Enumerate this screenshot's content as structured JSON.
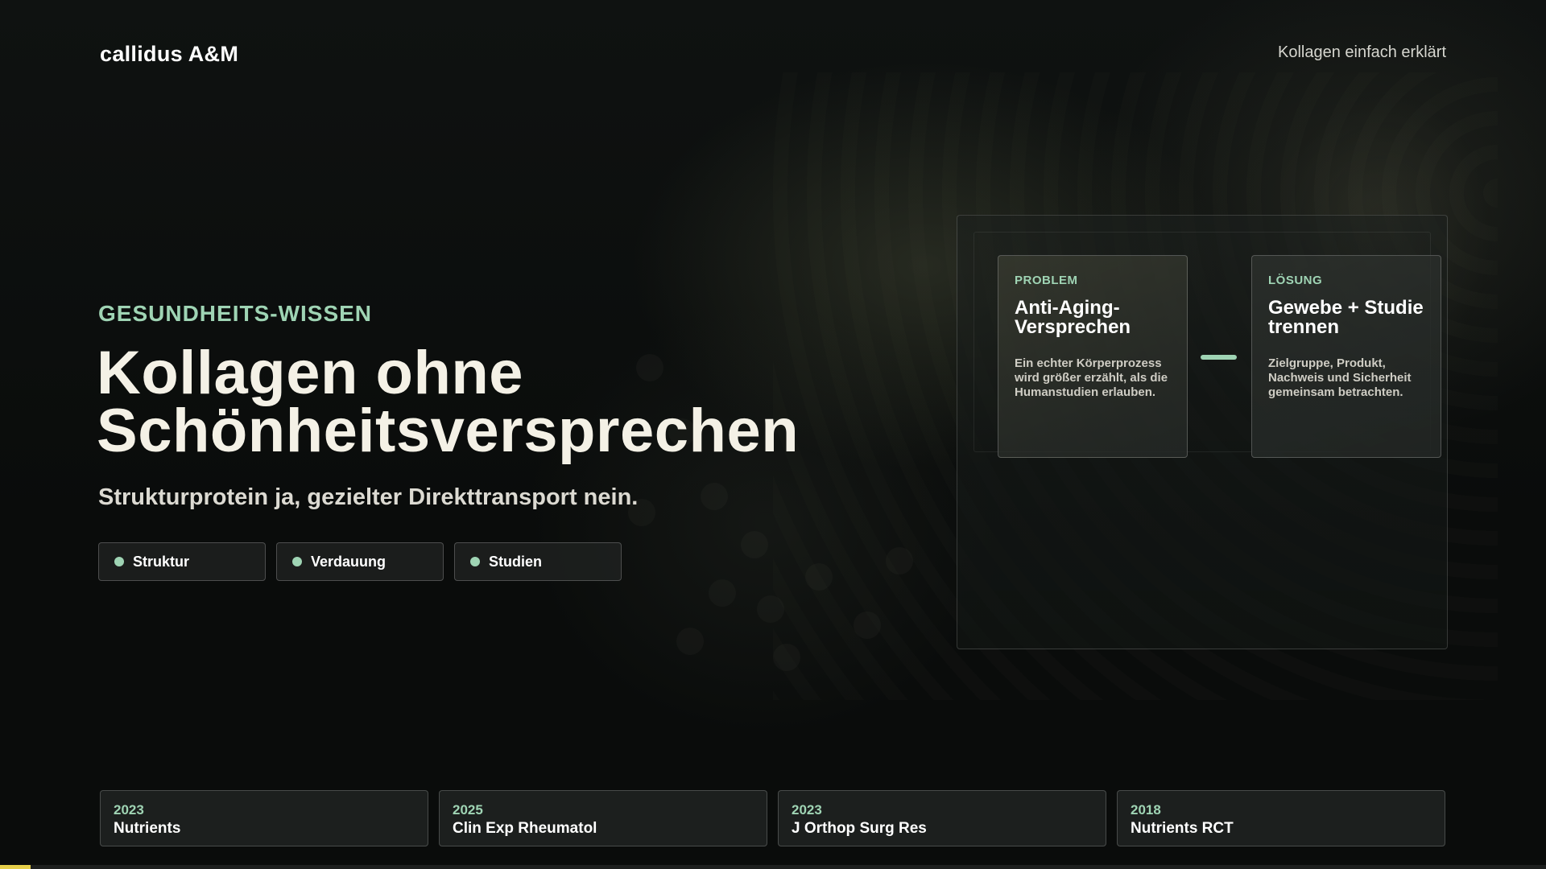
{
  "header": {
    "brand": "callidus A&M",
    "nav_link": "Kollagen einfach erklärt"
  },
  "hero": {
    "eyebrow": "GESUNDHEITS-WISSEN",
    "title_line1": "Kollagen ohne",
    "title_line2": "Schönheitsversprechen",
    "subtitle": "Strukturprotein ja, gezielter Direkttransport nein.",
    "chips": [
      {
        "label": "Struktur"
      },
      {
        "label": "Verdauung"
      },
      {
        "label": "Studien"
      }
    ]
  },
  "panel": {
    "problem": {
      "label": "PROBLEM",
      "title": "Anti-Aging-Versprechen",
      "text": "Ein echter Körperprozess wird größer erzählt, als die Humanstudien erlauben."
    },
    "solution": {
      "label": "LÖSUNG",
      "title": "Gewebe + Studie trennen",
      "text": "Zielgruppe, Produkt, Nachweis und Sicherheit gemeinsam betrachten."
    }
  },
  "references": [
    {
      "year": "2023",
      "journal": "Nutrients"
    },
    {
      "year": "2025",
      "journal": "Clin Exp Rheumatol"
    },
    {
      "year": "2023",
      "journal": "J Orthop Surg Res"
    },
    {
      "year": "2018",
      "journal": "Nutrients RCT"
    }
  ],
  "progress": {
    "fraction": 0.02
  },
  "colors": {
    "accent": "#9fd4b4",
    "progress": "#e6cf4a",
    "background": "#0b0d0c"
  }
}
